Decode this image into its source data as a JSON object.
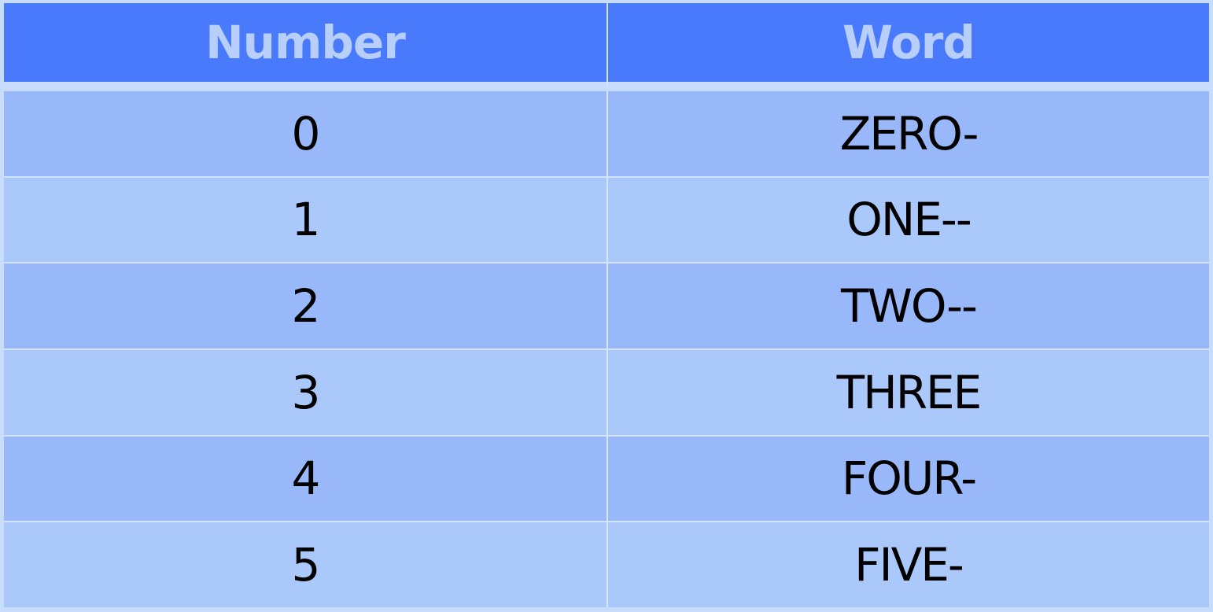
{
  "table": {
    "headers": [
      "Number",
      "Word"
    ],
    "rows": [
      [
        "0",
        "ZERO-"
      ],
      [
        "1",
        "ONE--"
      ],
      [
        "2",
        "TWO--"
      ],
      [
        "3",
        "THREE"
      ],
      [
        "4",
        "FOUR-"
      ],
      [
        "5",
        "FIVE-"
      ]
    ]
  },
  "colors": {
    "header_bg": "#4a7afc",
    "header_text": "#b9cffb",
    "row_dark": "#99b8f9",
    "row_light": "#abc8fa",
    "page_bg": "#c7ddfb"
  }
}
